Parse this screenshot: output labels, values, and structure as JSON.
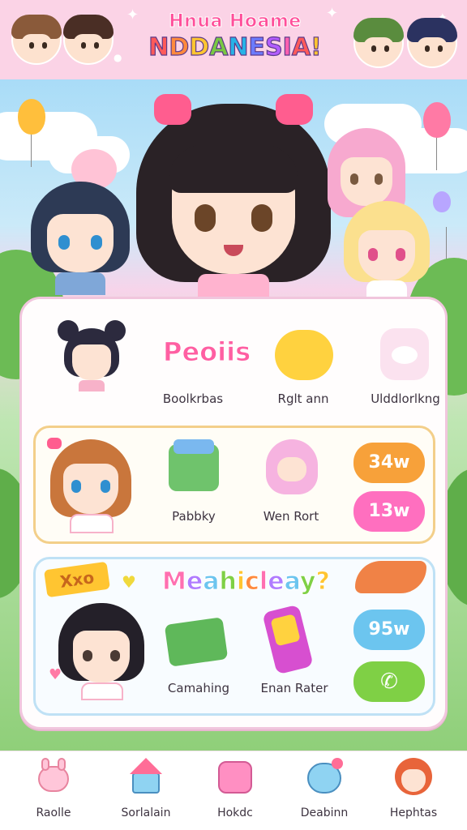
{
  "header": {
    "title_top": "Hnua Hoame",
    "title_main": "NDDANESIA!",
    "title_letter_colors": [
      "#ff5a5a",
      "#ff8a3d",
      "#ffc531",
      "#7ac943",
      "#27b2e6",
      "#6b7bff",
      "#b25cff",
      "#ff5fb0",
      "#ff5a5a",
      "#ffc531"
    ],
    "avatars": [
      {
        "icon": "brown-hair-girl-avatar",
        "hair": "#8a5a3a"
      },
      {
        "icon": "dark-brown-hair-girl-avatar",
        "hair": "#4a2e25"
      },
      {
        "icon": "green-hair-boy-avatar",
        "hair": "#5a8c3e"
      },
      {
        "icon": "navy-hair-girl-avatar",
        "hair": "#2b3260"
      }
    ]
  },
  "hero": {
    "characters": [
      "black-hair-girl-with-pink-bows",
      "navy-hair-girl",
      "pink-hair-girl",
      "blonde-hair-girl"
    ]
  },
  "panel": {
    "row1": {
      "big_word": "Peoiis",
      "big_word_color": "#ff5fa2",
      "labels": [
        "Boolkrbas",
        "Rglt ann",
        "Ulddlorlkng"
      ],
      "icons": [
        "chibi-girl-bun-hair",
        "yellow-cat-face-icon",
        "bird-card-icon"
      ]
    },
    "row2": {
      "labels": [
        "Pabbky",
        "Wen Rort"
      ],
      "badges": [
        {
          "label": "34w",
          "color": "#f7a13a"
        },
        {
          "label": "13w",
          "color": "#ff6fbf"
        }
      ],
      "icons": [
        "chibi-girl-orange-hair",
        "cake-box-icon",
        "pink-cat-girl-icon"
      ]
    },
    "row3": {
      "ticket_word": "Xxo",
      "big_word": "Meahicleay?",
      "labels": [
        "Camahing",
        "Enan Rater"
      ],
      "badges": [
        {
          "label": "95w",
          "color": "#6cc5ef"
        }
      ],
      "call_button": {
        "icon": "phone-icon",
        "color": "#7fd045"
      },
      "icons": [
        "chibi-boy-black-hair",
        "pencil-tray-icon",
        "phone-device-icon",
        "orange-fox-icon"
      ]
    }
  },
  "nav": {
    "items": [
      {
        "label": "Raolle",
        "icon": "pink-bunny-icon"
      },
      {
        "label": "Sorlalain",
        "icon": "house-icon"
      },
      {
        "label": "Hokdc",
        "icon": "pink-cat-icon"
      },
      {
        "label": "Deabinn",
        "icon": "blue-blob-icon"
      },
      {
        "label": "Hephtas",
        "icon": "girl-face-icon"
      }
    ]
  }
}
